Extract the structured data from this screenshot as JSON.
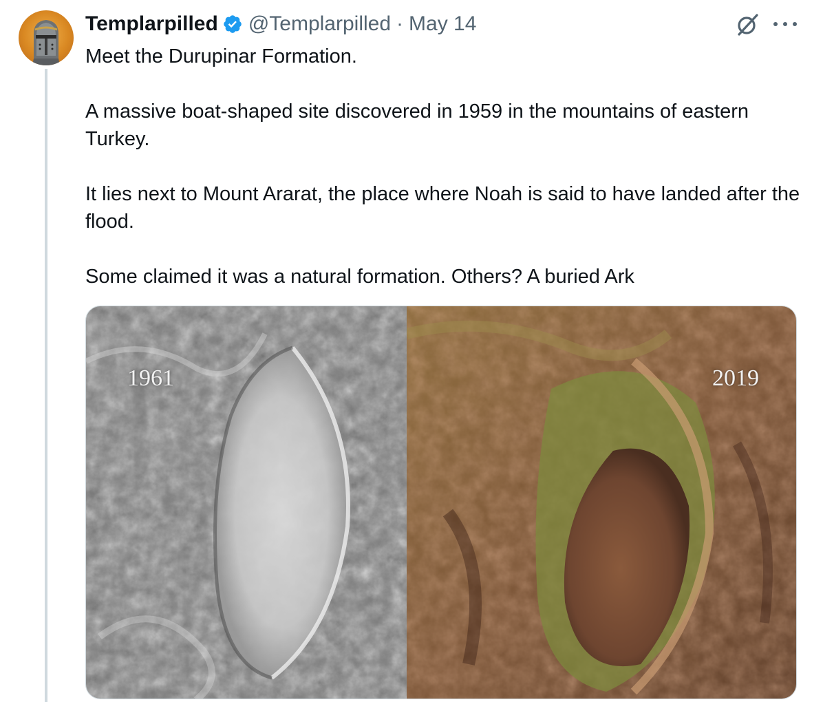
{
  "tweet": {
    "display_name": "Templarpilled",
    "handle": "@Templarpilled",
    "separator": "·",
    "date": "May 14",
    "paragraphs": [
      "Meet the Durupinar Formation.",
      "A massive boat-shaped site discovered in 1959 in the mountains of eastern Turkey.",
      "It lies next to Mount Ararat, the place where Noah is said to have landed after the flood.",
      "Some claimed it was a natural formation. Others? A buried Ark"
    ],
    "media": {
      "left_label": "1961",
      "right_label": "2019"
    }
  },
  "icons": {
    "verified": "verified-badge-icon",
    "grok": "grok-icon",
    "more": "more-options-icon"
  },
  "colors": {
    "verified_blue": "#1d9bf0",
    "text_primary": "#0f1419",
    "text_secondary": "#536471",
    "thread_line": "#cfd9de"
  }
}
